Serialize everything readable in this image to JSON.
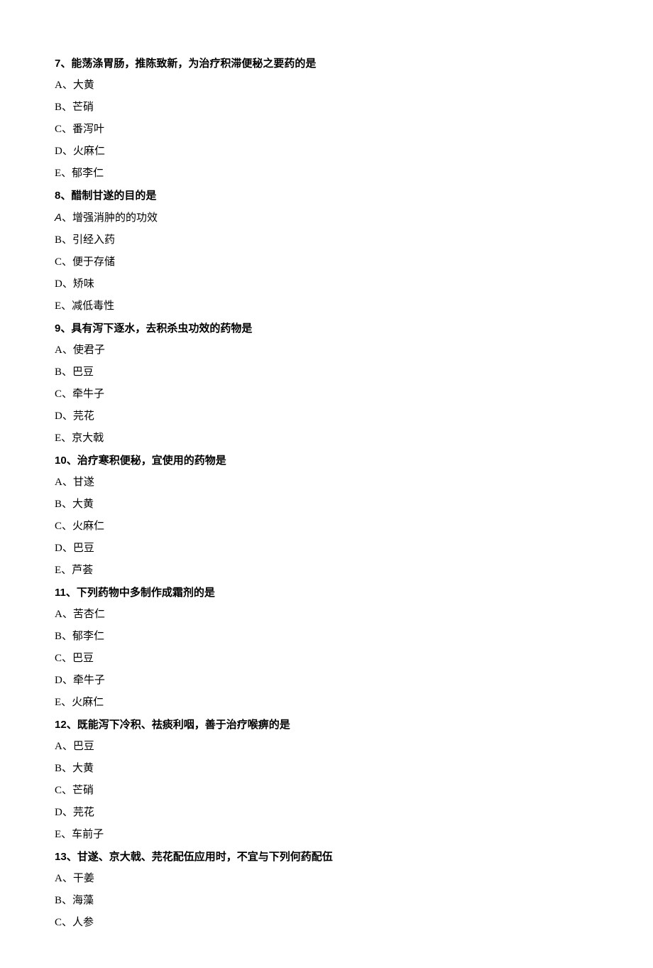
{
  "questions": [
    {
      "num": "7",
      "text": "、能荡涤胃肠，推陈致新，为治疗积滞便秘之要药的是",
      "opts": [
        {
          "letter": "A、",
          "text": "大黄"
        },
        {
          "letter": "B、",
          "text": "芒硝"
        },
        {
          "letter": "C、",
          "text": "番泻叶"
        },
        {
          "letter": "D、",
          "text": "火麻仁"
        },
        {
          "letter": "E、",
          "text": "郁李仁"
        }
      ]
    },
    {
      "num": "8",
      "text": "、醋制甘遂的目的是",
      "opts": [
        {
          "letter": "A",
          "sep": "、",
          "text": "增强消肿的的功效",
          "italic": true
        },
        {
          "letter": "B、",
          "text": "引经入药"
        },
        {
          "letter": "C、",
          "text": "便于存储"
        },
        {
          "letter": "D、",
          "text": "矫味"
        },
        {
          "letter": "E、",
          "text": "减低毒性"
        }
      ]
    },
    {
      "num": "9",
      "text": "、具有泻下逐水，去积杀虫功效的药物是",
      "opts": [
        {
          "letter": "A、",
          "text": "使君子"
        },
        {
          "letter": "B、",
          "text": "巴豆"
        },
        {
          "letter": "C、",
          "text": "牵牛子"
        },
        {
          "letter": "D、",
          "text": "芫花"
        },
        {
          "letter": "E、",
          "text": "京大戟"
        }
      ]
    },
    {
      "num": "10",
      "text": "、治疗寒积便秘，宜使用的药物是",
      "opts": [
        {
          "letter": "A、",
          "text": "甘遂"
        },
        {
          "letter": "B、",
          "text": "大黄"
        },
        {
          "letter": "C、",
          "text": "火麻仁"
        },
        {
          "letter": "D、",
          "text": "巴豆"
        },
        {
          "letter": "E、",
          "text": "芦荟"
        }
      ]
    },
    {
      "num": "11",
      "text": "、下列药物中多制作成霜剂的是",
      "opts": [
        {
          "letter": "A、",
          "text": "苦杏仁"
        },
        {
          "letter": "B、",
          "text": "郁李仁"
        },
        {
          "letter": "C、",
          "text": "巴豆"
        },
        {
          "letter": "D、",
          "text": "牵牛子"
        },
        {
          "letter": "E、",
          "text": "火麻仁"
        }
      ]
    },
    {
      "num": "12",
      "text": "、既能泻下冷积、祛痰利咽，善于治疗喉痹的是",
      "opts": [
        {
          "letter": "A、",
          "text": "巴豆"
        },
        {
          "letter": "B、",
          "text": "大黄"
        },
        {
          "letter": "C、",
          "text": "芒硝"
        },
        {
          "letter": "D、",
          "text": "芫花"
        },
        {
          "letter": "E、",
          "text": "车前子"
        }
      ]
    },
    {
      "num": "13",
      "text": "、甘遂、京大戟、芫花配伍应用时，不宜与下列何药配伍",
      "opts": [
        {
          "letter": "A、",
          "text": "干姜"
        },
        {
          "letter": "B、",
          "text": "海藻"
        },
        {
          "letter": "C、",
          "text": "人参"
        }
      ]
    }
  ]
}
